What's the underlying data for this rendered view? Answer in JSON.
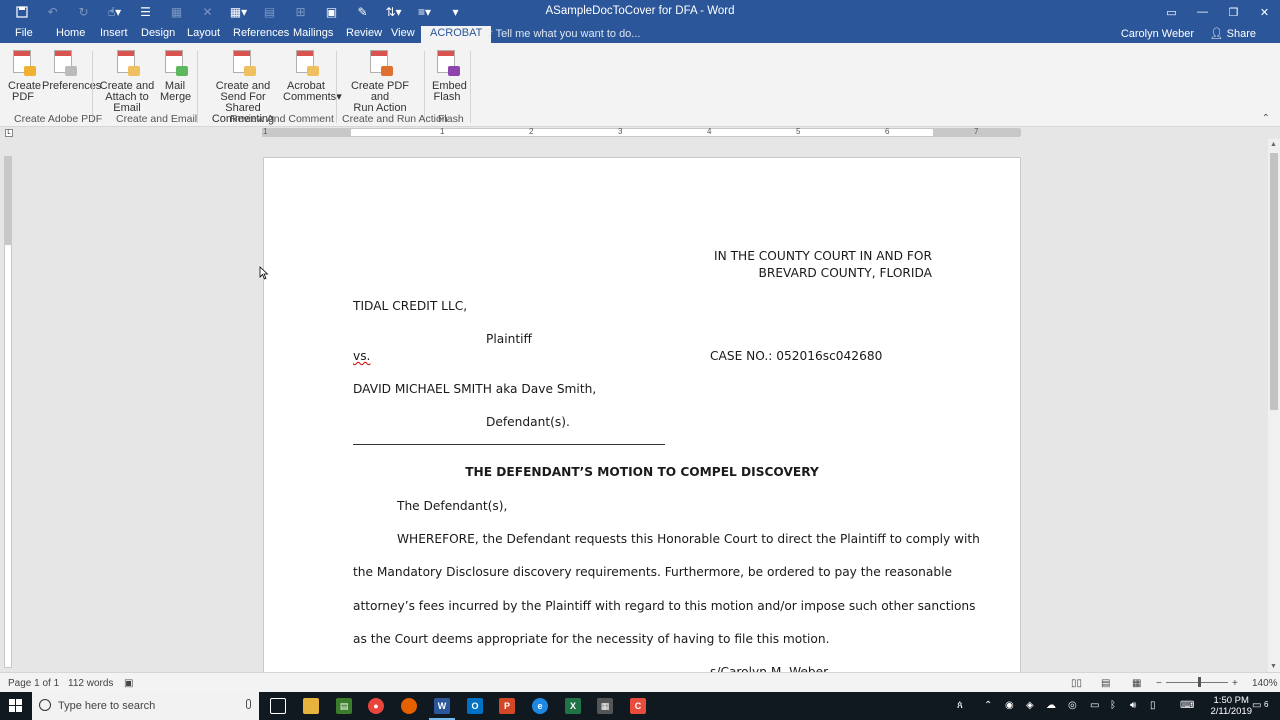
{
  "window": {
    "title": "ASampleDocToCover for DFA - Word",
    "user": "Carolyn Weber",
    "share_label": "Share"
  },
  "colors": {
    "accent": "#2b579a",
    "taskbar": "#101820",
    "acrobat_red": "#d9534f"
  },
  "qat_icons": [
    "save-icon",
    "undo-icon",
    "redo-icon",
    "touch-mode-icon",
    "list-icon",
    "table-icon",
    "calculator-icon",
    "format-painter-icon",
    "customize-icon"
  ],
  "tabs": [
    "File",
    "Home",
    "Insert",
    "Design",
    "Layout",
    "References",
    "Mailings",
    "Review",
    "View",
    "ACROBAT"
  ],
  "active_tab": "ACROBAT",
  "tell_me": "Tell me what you want to do...",
  "ribbon": {
    "create_pdf": "Create PDF",
    "create_pdf_l1": "Create",
    "create_pdf_l2": "PDF",
    "preferences": "Preferences",
    "attach_l1": "Create and",
    "attach_l2": "Attach to Email",
    "merge_l1": "Mail",
    "merge_l2": "Merge",
    "send_l1": "Create and Send For",
    "send_l2": "Shared Commenting",
    "comments_l1": "Acrobat",
    "comments_l2": "Comments",
    "run_l1": "Create PDF and",
    "run_l2": "Run Action",
    "flash_l1": "Embed",
    "flash_l2": "Flash",
    "groups": [
      "Create Adobe PDF",
      "Create and Email",
      "Review And Comment",
      "Create and Run Action",
      "Flash"
    ]
  },
  "ruler_numbers": [
    "1",
    "1",
    "2",
    "3",
    "4",
    "5",
    "6",
    "7"
  ],
  "document": {
    "court_line1": "IN THE COUNTY COURT IN AND FOR",
    "court_line2": "BREVARD COUNTY, FLORIDA",
    "plaintiff_name": "TIDAL CREDIT LLC,",
    "plaintiff_label": "Plaintiff",
    "vs": "vs.",
    "case_no": "CASE NO.:  052016sc042680",
    "defendant_name": "DAVID MICHAEL SMITH aka Dave Smith,",
    "defendant_label": "Defendant(s).",
    "motion_title": "THE DEFENDANT’S MOTION TO COMPEL DISCOVERY",
    "intro": "The Defendant(s),",
    "body_1": "WHEREFORE, the Defendant requests this Honorable Court to direct the Plaintiff to comply with",
    "body_2": "the Mandatory Disclosure discovery requirements.  Furthermore, be ordered to pay the reasonable",
    "body_3": "attorney’s fees incurred by the Plaintiff with regard to this motion and/or impose such other sanctions",
    "body_4": "as the Court deems appropriate for the necessity of having to file this motion.",
    "signature": "s/Carolyn M. Weber"
  },
  "status": {
    "page": "Page 1 of 1",
    "words": "112 words",
    "zoom": "140%"
  },
  "taskbar": {
    "search_placeholder": "Type here to search",
    "time": "1:50 PM",
    "date": "2/11/2019",
    "notifications": "6"
  }
}
